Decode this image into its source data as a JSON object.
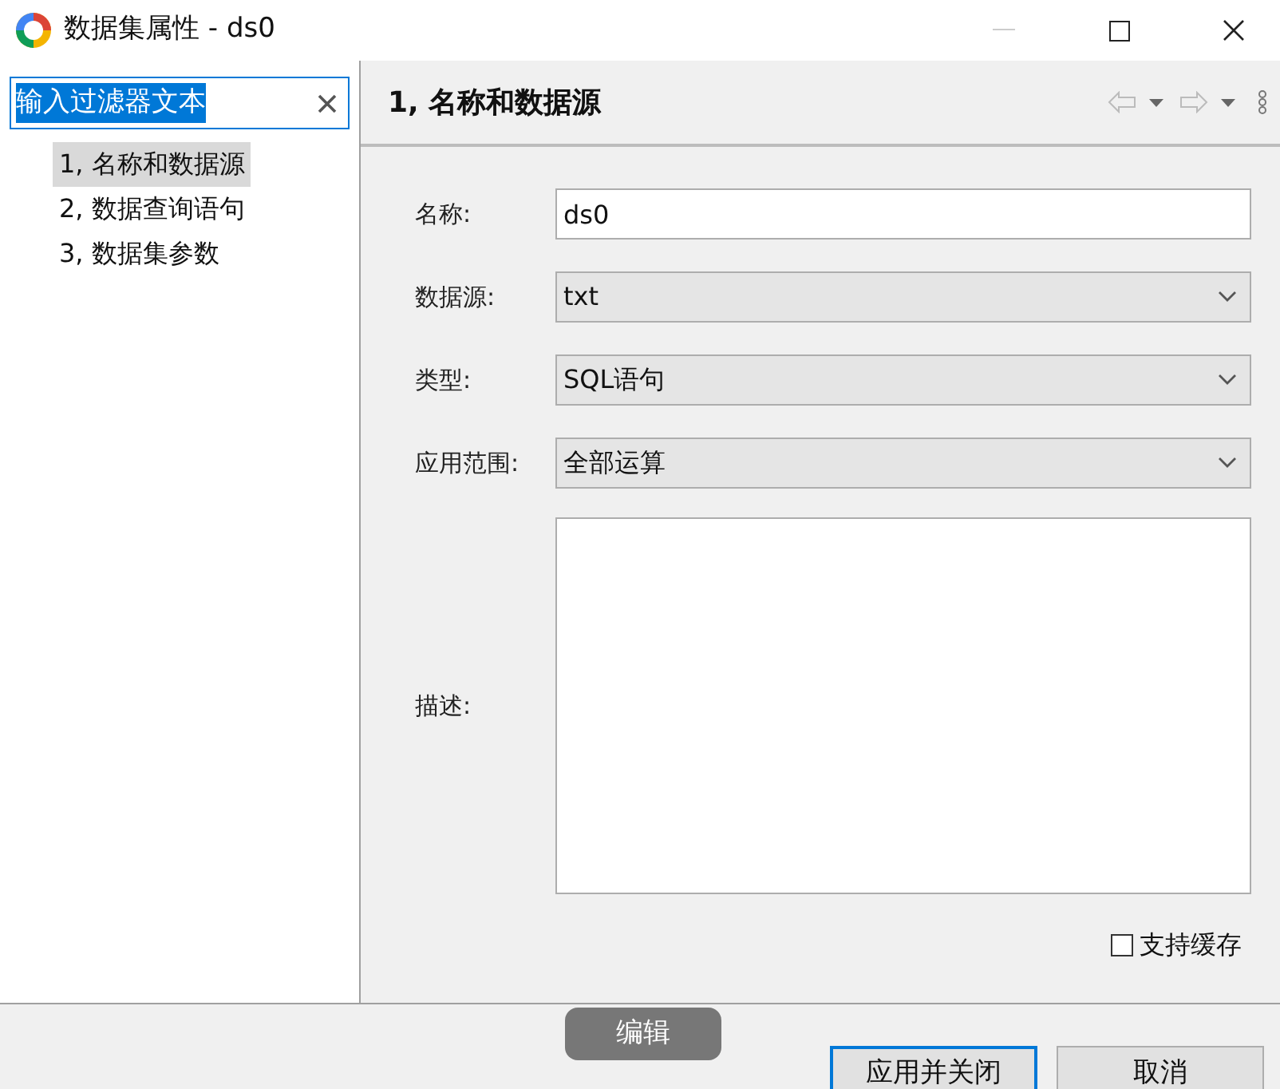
{
  "window": {
    "title": "数据集属性 - ds0"
  },
  "filter": {
    "value": "输入过滤器文本",
    "selected": true
  },
  "tree": [
    {
      "label": "1, 名称和数据源",
      "selected": true
    },
    {
      "label": "2, 数据查询语句",
      "selected": false
    },
    {
      "label": "3, 数据集参数",
      "selected": false
    }
  ],
  "page_title": "1, 名称和数据源",
  "form": [
    {
      "kind": "text",
      "label": "名称:",
      "value": "ds0"
    },
    {
      "kind": "select",
      "label": "数据源:",
      "value": "txt"
    },
    {
      "kind": "select",
      "label": "类型:",
      "value": "SQL语句"
    },
    {
      "kind": "select",
      "label": "应用范围:",
      "value": "全部运算"
    },
    {
      "kind": "textarea",
      "label": "描述:"
    }
  ],
  "cache": {
    "label": "支持缓存",
    "checked": false
  },
  "edit_button": "编辑",
  "buttons": [
    {
      "label": "应用并关闭",
      "default": true
    },
    {
      "label": "取消",
      "default": false
    }
  ]
}
